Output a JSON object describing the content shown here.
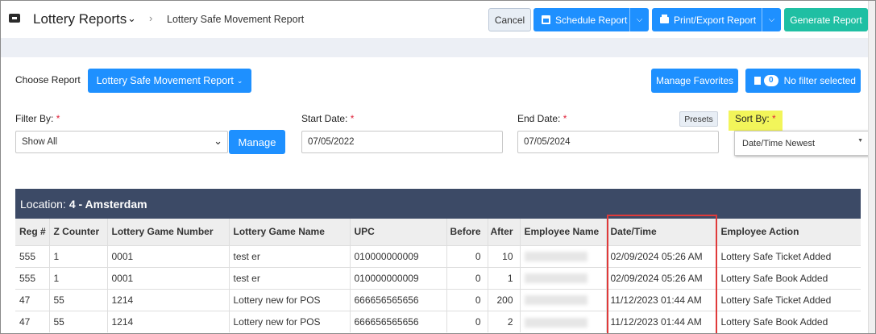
{
  "header": {
    "app_title": "Lottery Reports",
    "breadcrumb": "Lottery Safe Movement Report",
    "cancel_label": "Cancel",
    "schedule_label": "Schedule Report",
    "print_label": "Print/Export Report",
    "generate_label": "Generate Report"
  },
  "controls": {
    "choose_report_label": "Choose Report",
    "report_value": "Lottery Safe Movement Report",
    "manage_favorites_label": "Manage Favorites",
    "filter_count": "0",
    "no_filter_label": "No filter selected",
    "filter_by_label": "Filter By:",
    "filter_by_value": "Show All",
    "manage_label": "Manage",
    "start_date_label": "Start Date:",
    "start_date_value": "07/05/2022",
    "end_date_label": "End Date:",
    "end_date_value": "07/05/2024",
    "presets_label": "Presets",
    "sort_by_label": "Sort By:",
    "sort_by_value": "Date/Time Newest",
    "required_mark": "*"
  },
  "table": {
    "location_prefix": "Location:",
    "location_name": "4 - Amsterdam",
    "columns": [
      "Reg #",
      "Z Counter",
      "Lottery Game Number",
      "Lottery Game Name",
      "UPC",
      "Before",
      "After",
      "Employee Name",
      "Date/Time",
      "Employee Action"
    ],
    "rows": [
      [
        "555",
        "1",
        "0001",
        "test er",
        "010000000009",
        "0",
        "10",
        "",
        "02/09/2024 05:26 AM",
        "Lottery Safe Ticket Added"
      ],
      [
        "555",
        "1",
        "0001",
        "test er",
        "010000000009",
        "0",
        "1",
        "",
        "02/09/2024 05:26 AM",
        "Lottery Safe Book Added"
      ],
      [
        "47",
        "55",
        "1214",
        "Lottery new for POS",
        "666656565656",
        "0",
        "200",
        "",
        "11/12/2023 01:44 AM",
        "Lottery Safe Ticket Added"
      ],
      [
        "47",
        "55",
        "1214",
        "Lottery new for POS",
        "666656565656",
        "0",
        "2",
        "",
        "11/12/2023 01:44 AM",
        "Lottery Safe Book Added"
      ]
    ]
  },
  "colors": {
    "primary": "#1e90ff",
    "generate": "#1fbfa3",
    "location_bar": "#3c4a66",
    "highlight": "#f2f55a",
    "annotation_box": "#e03a3a"
  }
}
